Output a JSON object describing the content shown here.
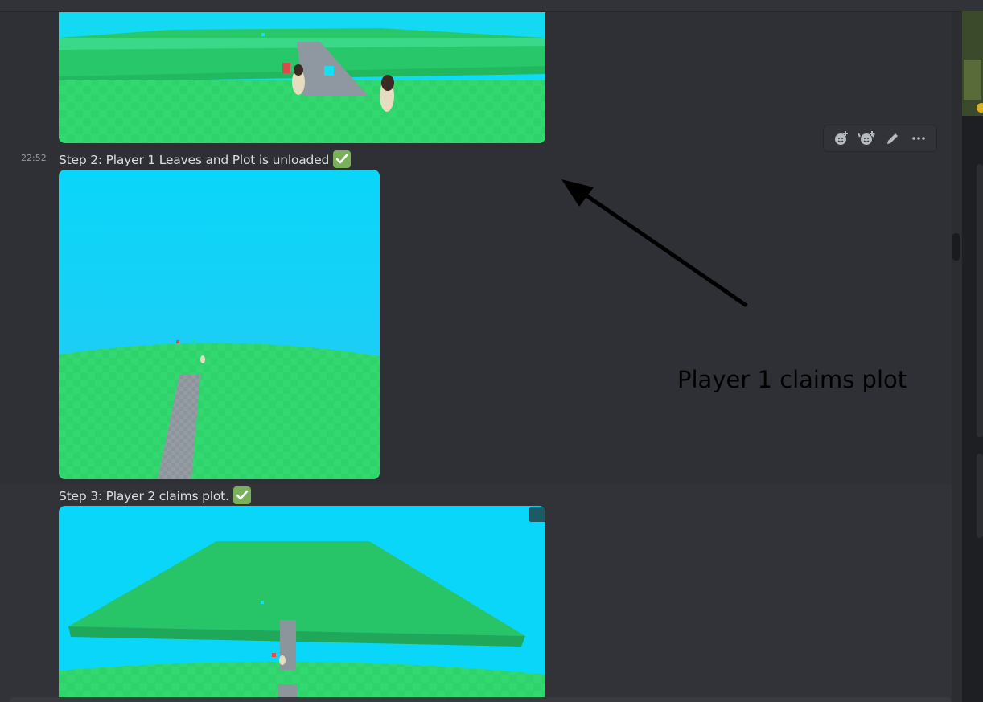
{
  "messages": {
    "timestamp": "22:52",
    "step2_text": "Step 2: Player 1 Leaves and Plot is unloaded",
    "step3_text": "Step 3: Player 2 claims plot.",
    "check_emoji": "white-check-mark"
  },
  "toolbar": {
    "icons": [
      "add-reaction-icon",
      "super-reaction-icon",
      "edit-icon",
      "more-icon"
    ]
  },
  "annotation": {
    "text": "Player 1 claims plot"
  },
  "colors": {
    "background": "#313338",
    "text": "#dbdee1",
    "check": "#78b159",
    "water": "#0fd5f5",
    "grass": "#2fd36b"
  }
}
